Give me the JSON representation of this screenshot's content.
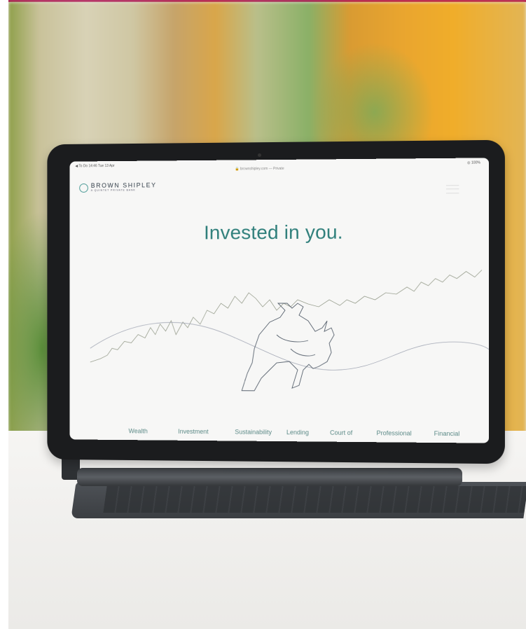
{
  "status_bar": {
    "left": "◀ To Do  14:46  Tue 13 Apr",
    "url": "🔒 brownshipley.com — Private",
    "right": "◎ 100%"
  },
  "brand": {
    "name": "BROWN SHIPLEY",
    "tagline": "A QUINTET PRIVATE BANK",
    "accent_color": "#2f7f7b",
    "logo_color": "#4a9a95"
  },
  "hero": {
    "headline": "Invested in you."
  },
  "nav": {
    "items": [
      "Wealth",
      "Investment",
      "Sustainability",
      "Lending",
      "Court of",
      "Professional",
      "Financial"
    ],
    "active_index": 2
  },
  "icons": {
    "menu": "hamburger-icon",
    "logo": "circle-logo-icon"
  }
}
